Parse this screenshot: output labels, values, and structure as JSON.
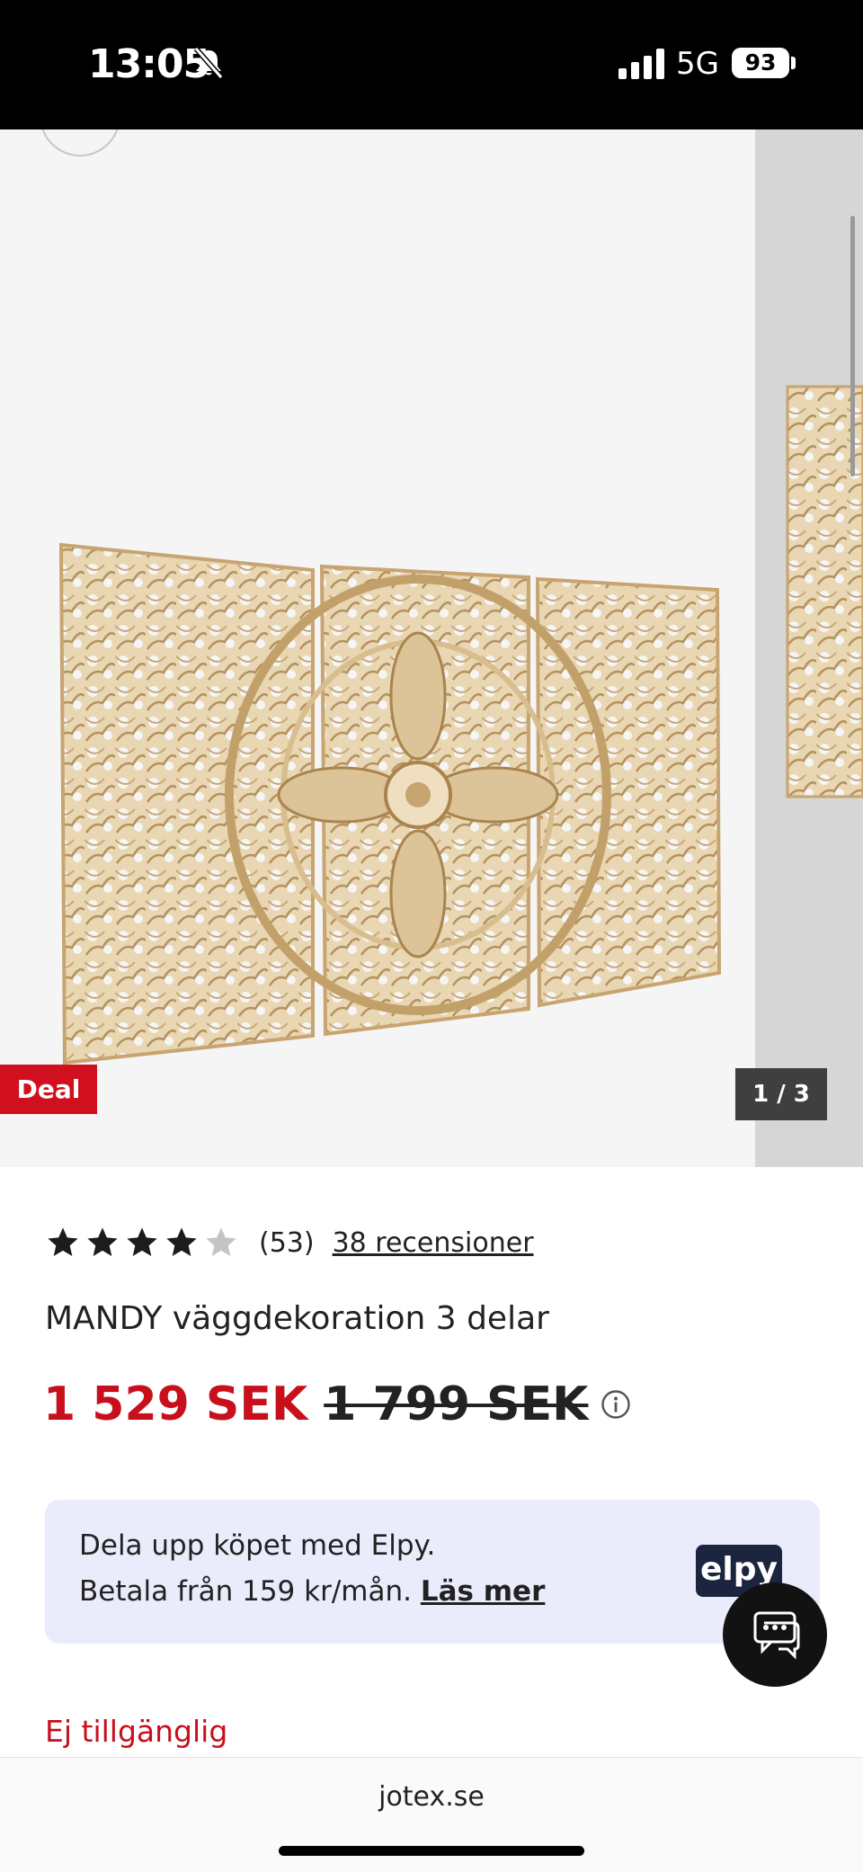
{
  "status_bar": {
    "time": "13:05",
    "network": "5G",
    "battery": "93"
  },
  "gallery": {
    "badge": "Deal",
    "counter": "1 / 3",
    "image_icon": "carved-wood-panels-image"
  },
  "product": {
    "rating": 4,
    "rating_count": "(53)",
    "reviews_link": "38 recensioner",
    "title": "MANDY väggdekoration 3 delar",
    "price_now": "1 529 SEK",
    "price_old": "1 799 SEK"
  },
  "elpy": {
    "line1": "Dela upp köpet med Elpy.",
    "line2": "Betala från 159 kr/mån.",
    "link": "Läs mer",
    "logo": "elpy"
  },
  "availability": "Ej tillgänglig",
  "browser": {
    "url": "jotex.se"
  },
  "colors": {
    "accent_red": "#c8101c",
    "deal_red": "#d0101e",
    "elpy_bg": "#ebecfb",
    "elpy_logo_bg": "#1c2540"
  }
}
